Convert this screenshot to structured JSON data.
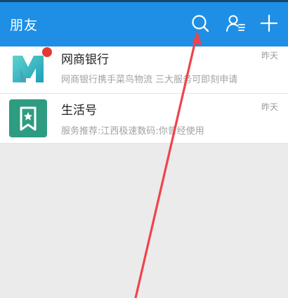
{
  "header": {
    "title": "朋友",
    "icons": {
      "search": "search-icon",
      "contacts": "contacts-icon",
      "add": "plus-icon"
    },
    "background_color": "#1f8fe5"
  },
  "conversations": [
    {
      "name": "网商银行",
      "preview": "网商银行携手菜鸟物流 三大服务可即刻申请",
      "time": "昨天",
      "avatar_icon": "mybank-logo-icon",
      "avatar_color": "#3cc0c5",
      "unread": true
    },
    {
      "name": "生活号",
      "preview": "服务推荐:江西极速数码:你曾经使用",
      "time": "昨天",
      "avatar_icon": "star-bookmark-icon",
      "avatar_color": "#2e9c81",
      "unread": false
    }
  ],
  "annotation": {
    "color": "#f0434a",
    "points_to": "search-icon"
  }
}
